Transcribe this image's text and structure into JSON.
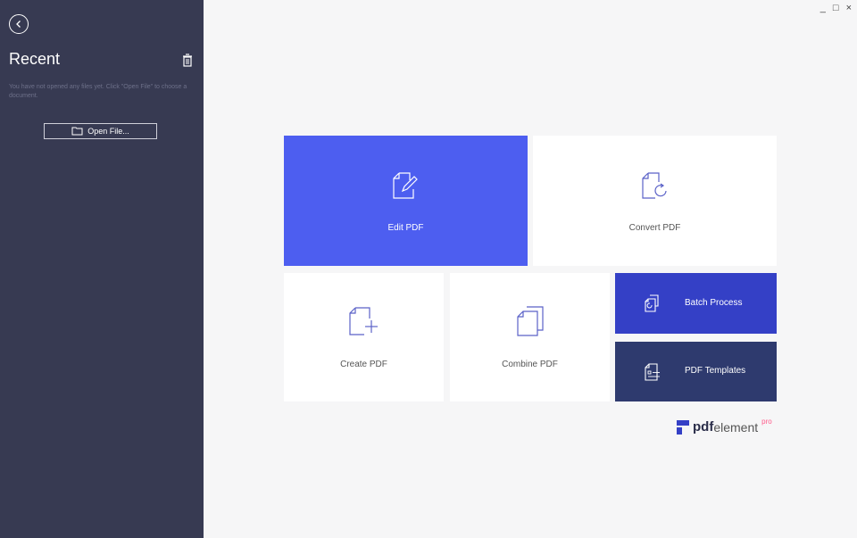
{
  "sidebar": {
    "title": "Recent",
    "empty_message": "You have not opened any files yet. Click \"Open File\" to choose a document.",
    "open_file_label": "Open File..."
  },
  "window_controls": {
    "minimize": "_",
    "maximize": "□",
    "close": "×"
  },
  "tiles": {
    "edit": "Edit PDF",
    "convert": "Convert PDF",
    "create": "Create PDF",
    "combine": "Combine PDF",
    "batch": "Batch Process",
    "templates": "PDF Templates"
  },
  "brand": {
    "bold": "pdf",
    "light": "element",
    "tag": "pro"
  },
  "colors": {
    "sidebar": "#373a52",
    "edit_tile": "#4d5ef0",
    "batch_tile": "#3440c6",
    "templates_tile": "#2e3a6e",
    "icon_stroke": "#5b62c8"
  },
  "icons": [
    "back-arrow",
    "trash",
    "folder",
    "edit-doc",
    "convert-doc",
    "create-doc",
    "combine-doc",
    "batch-doc",
    "template-doc",
    "pdfelement-logo"
  ]
}
